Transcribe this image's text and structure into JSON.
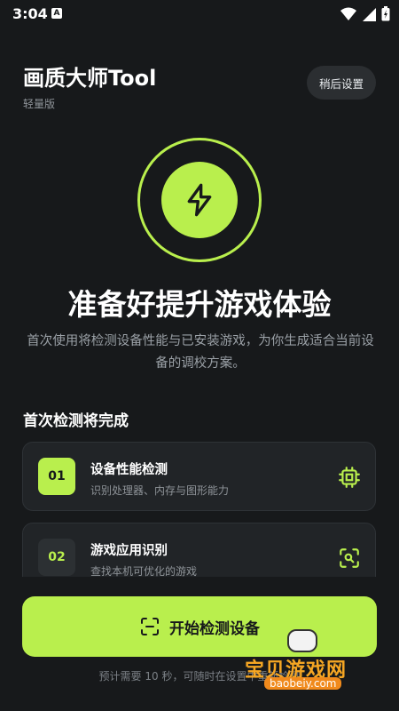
{
  "status_bar": {
    "time": "3:04",
    "notification_glyph": "A"
  },
  "header": {
    "title": "画质大师Tool",
    "subtitle": "轻量版",
    "later_button": "稍后设置"
  },
  "hero": {
    "icon": "lightning-bolt-icon",
    "accent": "#b9ef4d"
  },
  "headline": "准备好提升游戏体验",
  "description": "首次使用将检测设备性能与已安装游戏，为你生成适合当前设备的调校方案。",
  "section_title": "首次检测将完成",
  "steps": [
    {
      "num": "01",
      "title": "设备性能检测",
      "desc": "识别处理器、内存与图形能力",
      "icon": "chip-icon"
    },
    {
      "num": "02",
      "title": "游戏应用识别",
      "desc": "查找本机可优化的游戏",
      "icon": "scan-search-icon"
    }
  ],
  "start_button": {
    "label": "开始检测设备",
    "icon": "scan-frame-icon"
  },
  "footer_note": "预计需要 10 秒，可随时在设置中重新检测",
  "watermark": {
    "text": "宝贝游戏网",
    "url": "baobeiy.com"
  },
  "colors": {
    "background": "#17191b",
    "accent": "#b9ef4d",
    "card": "#212427"
  }
}
